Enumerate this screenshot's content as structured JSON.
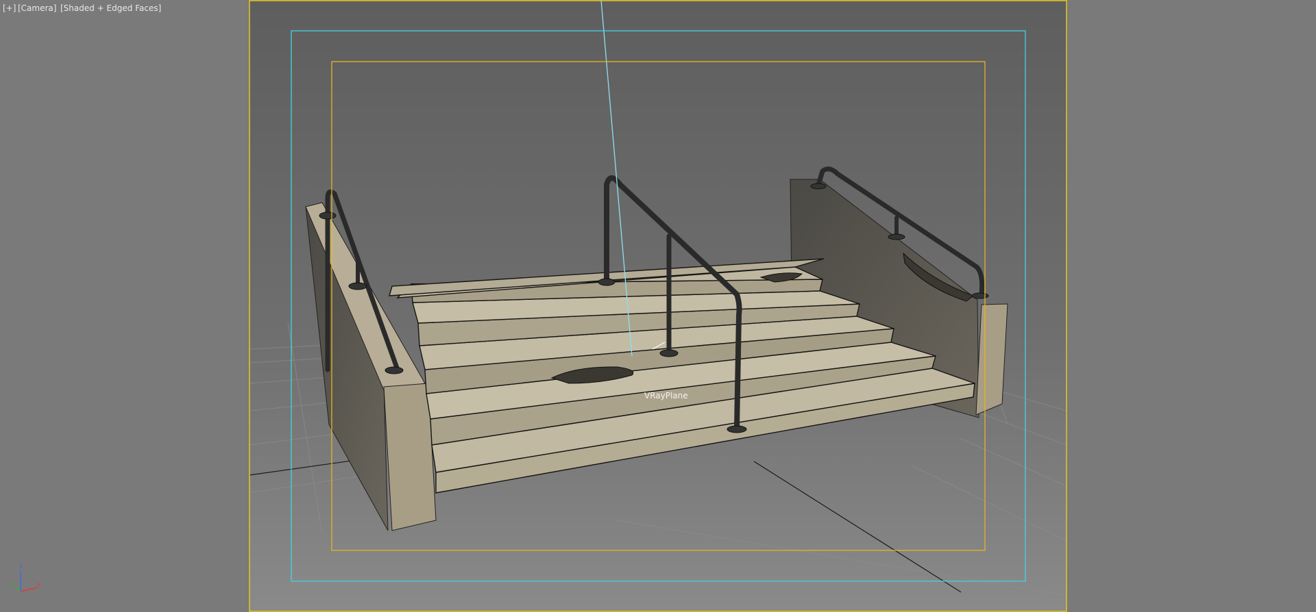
{
  "viewport": {
    "menu_plus": "[+]",
    "menu_camera": "[Camera]",
    "menu_shading": "[Shaded + Edged Faces]"
  },
  "scene": {
    "object_label": "VRayPlane",
    "gizmo_axes": {
      "z": "z",
      "x": "x",
      "y": "y"
    }
  },
  "colors": {
    "viewport_bg": "#7a7a7a",
    "render_frame": "#646464",
    "safe_frame_outer": "#e6c61f",
    "safe_frame_action": "#45d2e6",
    "safe_frame_title": "#e6b41f",
    "stone": "#b7ad95",
    "wall": "#55524b",
    "rail": "#2a2a2a"
  }
}
